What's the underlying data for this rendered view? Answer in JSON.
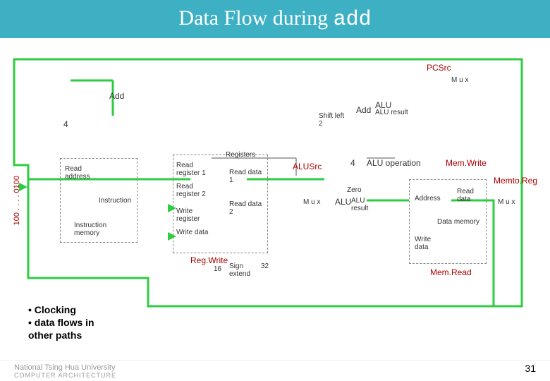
{
  "title": {
    "prefix": "Data Flow during ",
    "suffix": "add"
  },
  "signals": {
    "pcsrc": "PCSrc",
    "alusrc": "ALUSrc",
    "aluop": "ALU operation",
    "memwrite": "Mem.Write",
    "memtoreg": "Memto.Reg",
    "memread": "Mem.Read",
    "regwrite": "Reg.Write",
    "zero": "Zero"
  },
  "blocks": {
    "add1": "Add",
    "add2": "Add",
    "aluresult": "ALU result",
    "shiftleft2": "Shift left 2",
    "registers": "Registers",
    "readreg1": "Read register 1",
    "readreg2": "Read register 2",
    "writereg": "Write register",
    "writedata_reg": "Write data",
    "readdata1": "Read data 1",
    "readdata2": "Read data 2",
    "readaddr": "Read address",
    "instruction": "Instruction",
    "instrmem": "Instruction memory",
    "signextend": "Sign extend",
    "alu": "ALU",
    "aluresult2": "ALU result",
    "address": "Address",
    "writedata_mem": "Write data",
    "datamem": "Data memory",
    "readdata_mem": "Read data",
    "mux": "M u x"
  },
  "numbers": {
    "four1": "4",
    "four2": "4",
    "sixteen": "16",
    "thirtytwo": "32"
  },
  "pc_value": "100 . . . . 0100",
  "bullets": {
    "b1": "• Clocking",
    "b2": "• data flows in",
    "b3": "  other paths"
  },
  "page": "31",
  "footer": {
    "uni": "National Tsing Hua University",
    "dept": "COMPUTER ARCHITECTURE"
  }
}
